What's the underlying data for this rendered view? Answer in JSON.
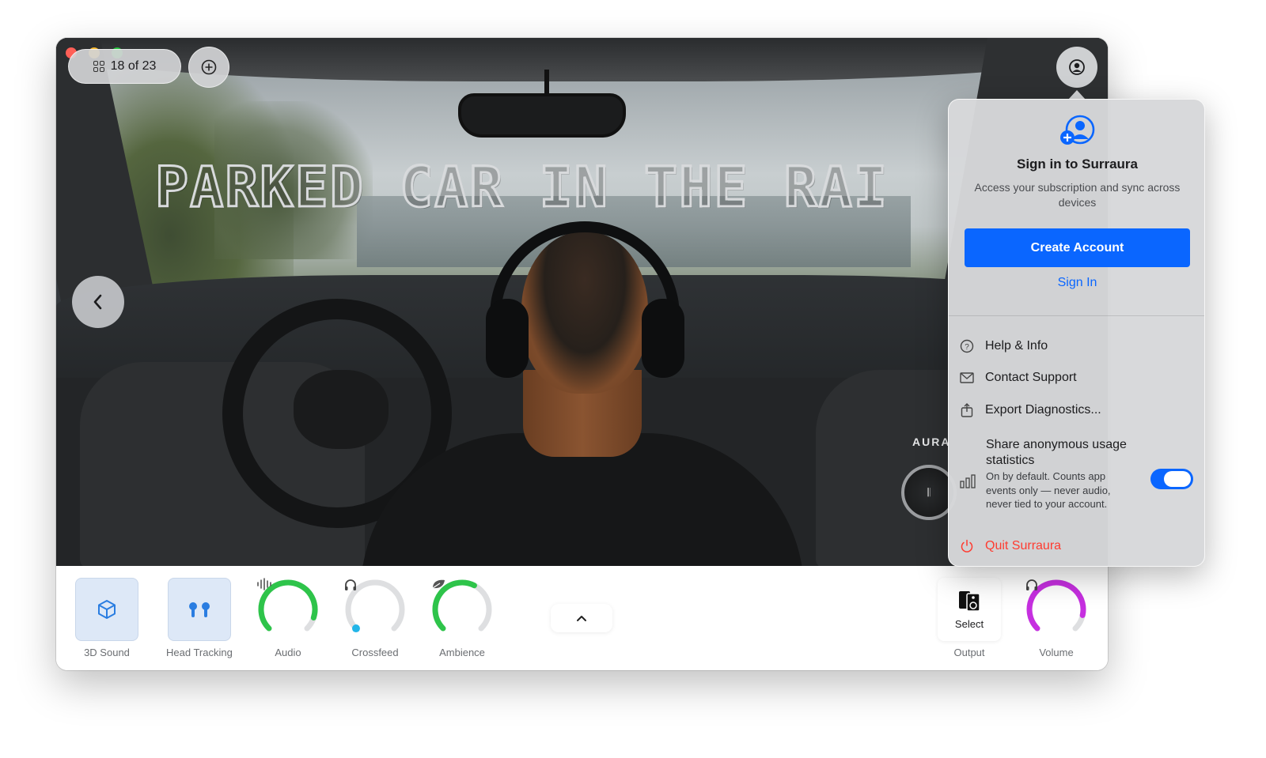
{
  "window": {
    "counter": "18 of 23",
    "scene_title": "PARKED CAR IN THE RAI",
    "aura_label": "AURA"
  },
  "controls": {
    "sound3d_label": "3D Sound",
    "head_tracking_label": "Head Tracking",
    "audio_label": "Audio",
    "crossfeed_label": "Crossfeed",
    "ambience_label": "Ambience",
    "output_button": "Select",
    "output_label": "Output",
    "volume_label": "Volume",
    "audio_level": 0.9,
    "crossfeed_level": 0.0,
    "ambience_level": 0.6,
    "volume_level": 0.88,
    "colors": {
      "green": "#2ec44a",
      "magenta": "#c62fe0",
      "blue": "#2a7de1",
      "track": "#dedfe1"
    }
  },
  "popover": {
    "title": "Sign in to Surraura",
    "subtitle": "Access your subscription and sync across devices",
    "create_account": "Create Account",
    "sign_in": "Sign In",
    "help": "Help & Info",
    "contact": "Contact Support",
    "export": "Export Diagnostics...",
    "share_title": "Share anonymous usage statistics",
    "share_desc": "On by default. Counts app events only — never audio, never tied to your account.",
    "share_enabled": true,
    "quit": "Quit Surraura",
    "accent": "#0a66ff"
  },
  "icons": [
    "grid-icon",
    "plus-circle-icon",
    "chevron-left-icon",
    "person-circle-icon",
    "person-add-icon",
    "cube-icon",
    "airpods-icon",
    "waveform-icon",
    "headphones-icon",
    "leaf-icon",
    "chevron-up-icon",
    "speaker-icon",
    "question-icon",
    "envelope-icon",
    "share-icon",
    "bar-chart-icon",
    "power-icon"
  ]
}
